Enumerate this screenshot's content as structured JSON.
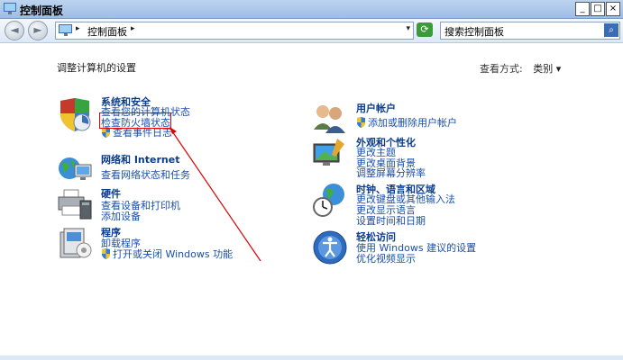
{
  "window": {
    "title": "控制面板",
    "minimize": "_",
    "maximize": "□",
    "close": "×"
  },
  "nav": {
    "back": "◄",
    "forward": "►"
  },
  "address": {
    "separator": "▸",
    "text": "控制面板",
    "sep2": "▸",
    "dropdown": "▾"
  },
  "search": {
    "value": "搜索控制面板",
    "button": "⌕"
  },
  "main": {
    "heading": "调整计算机的设置",
    "view_by_label": "查看方式:",
    "view_by_value": "类别 ▾"
  },
  "left": [
    {
      "title": "系统和安全",
      "links": [
        "查看您的计算机状态",
        "检查防火墙状态",
        "查看事件日志"
      ]
    },
    {
      "title": "网络和 Internet",
      "links": [
        "查看网络状态和任务"
      ]
    },
    {
      "title": "硬件",
      "links": [
        "查看设备和打印机",
        "添加设备"
      ]
    },
    {
      "title": "程序",
      "links": [
        "卸载程序",
        "打开或关闭 Windows 功能"
      ]
    }
  ],
  "right": [
    {
      "title": "用户帐户",
      "links": [
        "添加或删除用户帐户"
      ]
    },
    {
      "title": "外观和个性化",
      "links": [
        "更改主题",
        "更改桌面背景",
        "调整屏幕分辨率"
      ]
    },
    {
      "title": "时钟、语言和区域",
      "links": [
        "更改键盘或其他输入法",
        "更改显示语言",
        "设置时间和日期"
      ]
    },
    {
      "title": "轻松访问",
      "links": [
        "使用 Windows 建议的设置",
        "优化视频显示"
      ]
    }
  ],
  "colors": {
    "link": "#1a4fa8",
    "title": "#0a3c8c",
    "annotation": "#e00000"
  }
}
